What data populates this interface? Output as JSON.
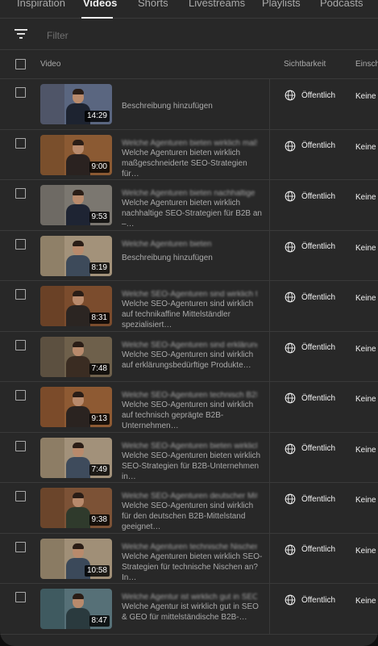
{
  "tabs": [
    {
      "label": "Inspiration",
      "active": false
    },
    {
      "label": "Videos",
      "active": true
    },
    {
      "label": "Shorts",
      "active": false
    },
    {
      "label": "Livestreams",
      "active": false
    },
    {
      "label": "Playlists",
      "active": false
    },
    {
      "label": "Podcasts",
      "active": false
    }
  ],
  "filter": {
    "placeholder": "Filter",
    "icon": "filter-icon"
  },
  "columns": {
    "video": "Video",
    "visibility": "Sichtbarkeit",
    "restrictions": "Einsch"
  },
  "rows": [
    {
      "duration": "14:29",
      "description": "Beschreibung hinzufügen",
      "visibility": "Öffentlich",
      "restriction": "Keine",
      "thumb": {
        "left": "#4f5568",
        "bg": "#5a6680",
        "shirt": "#1d2330"
      }
    },
    {
      "duration": "9:00",
      "description": "Welche Agenturen bieten wirklich maßgeschneiderte SEO-Strategien für…",
      "visibility": "Öffentlich",
      "restriction": "Keine",
      "thumb": {
        "left": "#7a4f2c",
        "bg": "#8b5a33",
        "shirt": "#2a2220"
      }
    },
    {
      "duration": "9:53",
      "description": "Welche Agenturen bieten wirklich nachhaltige SEO-Strategien für B2B an –…",
      "visibility": "Öffentlich",
      "restriction": "Keine",
      "thumb": {
        "left": "#6e6a64",
        "bg": "#7b7770",
        "shirt": "#1e2433"
      }
    },
    {
      "duration": "8:19",
      "description": "Beschreibung hinzufügen",
      "visibility": "Öffentlich",
      "restriction": "Keine",
      "thumb": {
        "left": "#8f8068",
        "bg": "#a3927a",
        "shirt": "#3d4a5a"
      }
    },
    {
      "duration": "8:31",
      "description": "Welche SEO-Agenturen sind wirklich auf technikaffine Mittelständler spezialisiert…",
      "visibility": "Öffentlich",
      "restriction": "Keine",
      "thumb": {
        "left": "#6a4126",
        "bg": "#7b4c2d",
        "shirt": "#2b2522"
      }
    },
    {
      "duration": "7:48",
      "description": "Welche SEO-Agenturen sind wirklich auf erklärungsbedürftige Produkte…",
      "visibility": "Öffentlich",
      "restriction": "Keine",
      "thumb": {
        "left": "#5c5040",
        "bg": "#6e604b",
        "shirt": "#3a2c22"
      }
    },
    {
      "duration": "9:13",
      "description": "Welche SEO-Agenturen sind wirklich auf technisch geprägte B2B-Unternehmen…",
      "visibility": "Öffentlich",
      "restriction": "Keine",
      "thumb": {
        "left": "#7b4b2a",
        "bg": "#8e5a33",
        "shirt": "#2a2320"
      }
    },
    {
      "duration": "7:49",
      "description": "Welche SEO-Agenturen bieten wirklich SEO-Strategien für B2B-Unternehmen in…",
      "visibility": "Öffentlich",
      "restriction": "Keine",
      "thumb": {
        "left": "#8d7d65",
        "bg": "#a2917a",
        "shirt": "#3e4b5c"
      }
    },
    {
      "duration": "9:38",
      "description": "Welche SEO-Agenturen sind wirklich für den deutschen B2B-Mittelstand geeignet…",
      "visibility": "Öffentlich",
      "restriction": "Keine",
      "thumb": {
        "left": "#6b452b",
        "bg": "#7c5236",
        "shirt": "#2f3a2c"
      }
    },
    {
      "duration": "10:58",
      "description": "Welche Agenturen bieten wirklich SEO-Strategien für technische Nischen an? In…",
      "visibility": "Öffentlich",
      "restriction": "Keine",
      "thumb": {
        "left": "#8a7b63",
        "bg": "#a08f77",
        "shirt": "#3b495a"
      }
    },
    {
      "duration": "8:47",
      "description": "Welche Agentur ist wirklich gut in SEO & GEO für mittelständische B2B-…",
      "visibility": "Öffentlich",
      "restriction": "Keine",
      "thumb": {
        "left": "#3f5a60",
        "bg": "#567077",
        "shirt": "#2a3a3e"
      }
    }
  ]
}
